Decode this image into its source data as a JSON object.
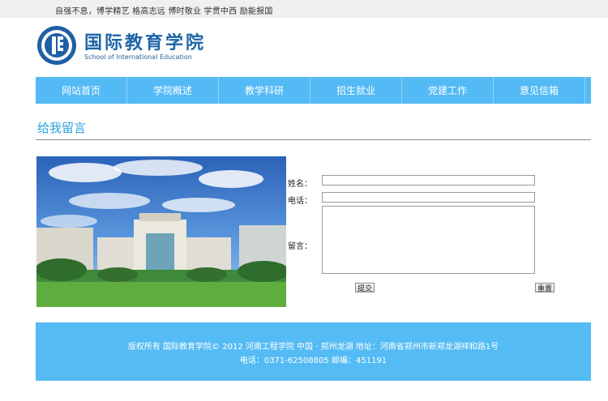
{
  "header": {
    "motto": "自强不息，博学精艺  格高志远  博时敬业  学贯中西  励能报国",
    "school_name": "国际教育学院",
    "school_name_en": "School of International Education"
  },
  "nav": {
    "items": [
      {
        "label": "网站首页"
      },
      {
        "label": "学院概述"
      },
      {
        "label": "教学科研"
      },
      {
        "label": "招生就业"
      },
      {
        "label": "党建工作"
      },
      {
        "label": "意见信箱"
      }
    ]
  },
  "page": {
    "title": "给我留言"
  },
  "form": {
    "name_label": "姓名：",
    "phone_label": "电话：",
    "message_label": "留言：",
    "name_value": "",
    "phone_value": "",
    "message_value": "",
    "submit_label": "提交",
    "reset_label": "重置"
  },
  "footer": {
    "line1": "版权所有  国际教育学院© 2012  河南工程学院  中国 · 郑州龙湖  地址：河南省郑州市新郑龙湖祥和路1号",
    "line2": "电话：0371-62508805  邮编：451191"
  },
  "colors": {
    "accent": "#53baf5",
    "heading": "#2da3e0",
    "brand": "#1f64a8"
  },
  "icons": {
    "logo": "school-emblem-logo"
  }
}
